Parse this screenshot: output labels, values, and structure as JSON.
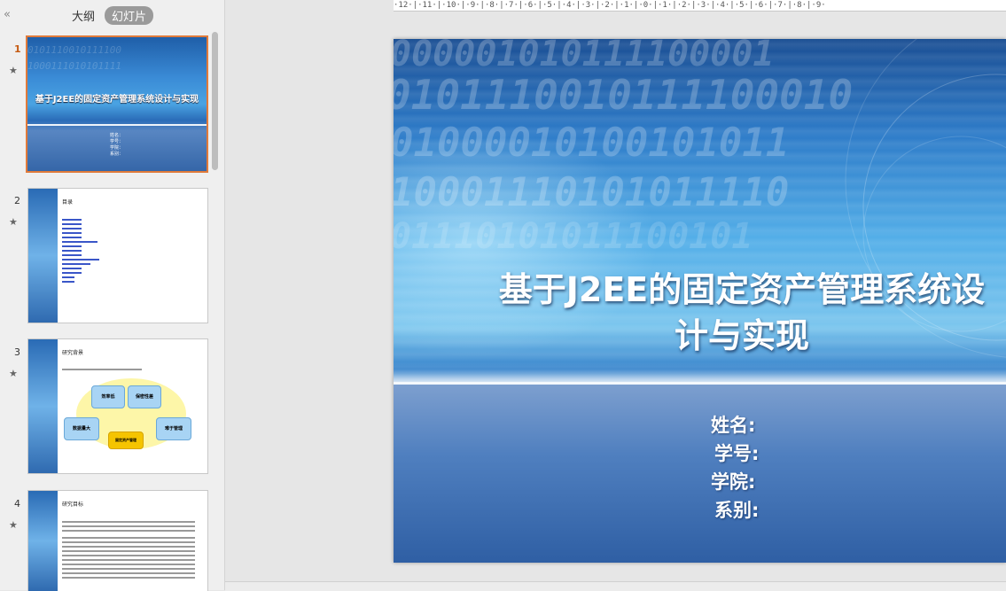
{
  "panel": {
    "collapse_icon": "«",
    "tab_outline": "大纲",
    "tab_slides": "幻灯片"
  },
  "thumbs": [
    {
      "num": "1",
      "title": "基于J2EE的固定资产管理系统设计与实现",
      "fields": [
        "姓名：",
        "学号：",
        "学院：",
        "系别："
      ]
    },
    {
      "num": "2",
      "title": "目录"
    },
    {
      "num": "3",
      "title": "研究背景",
      "boxes": [
        "效率低",
        "保密性差",
        "数据量大",
        "难于管理",
        "固定资产管理"
      ]
    },
    {
      "num": "4",
      "title": "研究目标"
    }
  ],
  "star_icon": "★",
  "ruler": "·12·|·11·|·10·|·9·|·8·|·7·|·6·|·5·|·4·|·3·|·2·|·1·|·0·|·1·|·2·|·3·|·4·|·5·|·6·|·7·|·8·|·9·",
  "slide": {
    "title_line1": "基于J2EE的固定资产管理系统设",
    "title_line2": "计与实现",
    "field_name": "姓名:",
    "field_id": "学号:",
    "field_college": "学院:",
    "field_dept": "系别:"
  },
  "colors": {
    "accent": "#e07a3a",
    "slide_blue": "#2d7bc8"
  }
}
